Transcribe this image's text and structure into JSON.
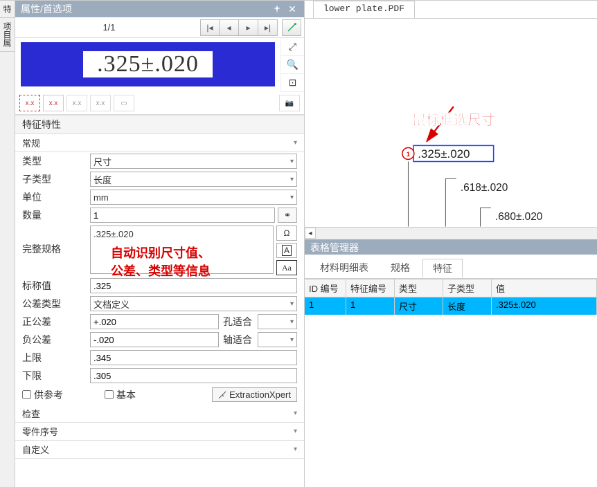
{
  "panel_title": "属性/首选项",
  "pager": "1/1",
  "preview_value": ".325±.020",
  "left_tabs": [
    "特",
    "项目属"
  ],
  "sections": {
    "char": "特征特性",
    "general": "常规"
  },
  "form": {
    "type_label": "类型",
    "type_value": "尺寸",
    "subtype_label": "子类型",
    "subtype_value": "长度",
    "unit_label": "单位",
    "unit_value": "mm",
    "qty_label": "数量",
    "qty_value": "1",
    "spec_label": "完整规格",
    "spec_value": ".325±.020",
    "nominal_label": "标称值",
    "nominal_value": ".325",
    "toltype_label": "公差类型",
    "toltype_value": "文档定义",
    "postol_label": "正公差",
    "postol_value": "+.020",
    "holefit_label": "孔适合",
    "holefit_value": "",
    "negtol_label": "负公差",
    "negtol_value": "-.020",
    "shaftfit_label": "轴适合",
    "shaftfit_value": "",
    "upper_label": "上限",
    "upper_value": ".345",
    "lower_label": "下限",
    "lower_value": ".305",
    "ref_label": "供参考",
    "basic_label": "基本",
    "ex_label": "ExtractionXpert"
  },
  "collapsed": {
    "inspect": "检查",
    "partseq": "零件序号",
    "custom": "自定义"
  },
  "annot_left": "自动识别尺寸值、\n公差、类型等信息",
  "pdf_tab": "lower plate.PDF",
  "annot_right": "鼠标框选尺寸",
  "dim1": ".325±.020",
  "dim2": ".618±.020",
  "dim3": ".680±.020",
  "balloon_num": "1",
  "tablemgr_title": "表格管理器",
  "tbl_tabs": {
    "bom": "材料明细表",
    "spec": "规格",
    "char": "特征"
  },
  "tbl_headers": {
    "id": "ID 编号",
    "charid": "特征编号",
    "type": "类型",
    "subtype": "子类型",
    "value": "值"
  },
  "tbl_row": {
    "id": "1",
    "charid": "1",
    "type": "尺寸",
    "subtype": "长度",
    "value": ".325±.020"
  },
  "icons": {
    "omega": "Ω",
    "A_plain": "A",
    "A_box": "Aa"
  },
  "chart_data": {
    "type": "table",
    "columns": [
      "ID 编号",
      "特征编号",
      "类型",
      "子类型",
      "值"
    ],
    "rows": [
      [
        "1",
        "1",
        "尺寸",
        "长度",
        ".325±.020"
      ]
    ]
  }
}
